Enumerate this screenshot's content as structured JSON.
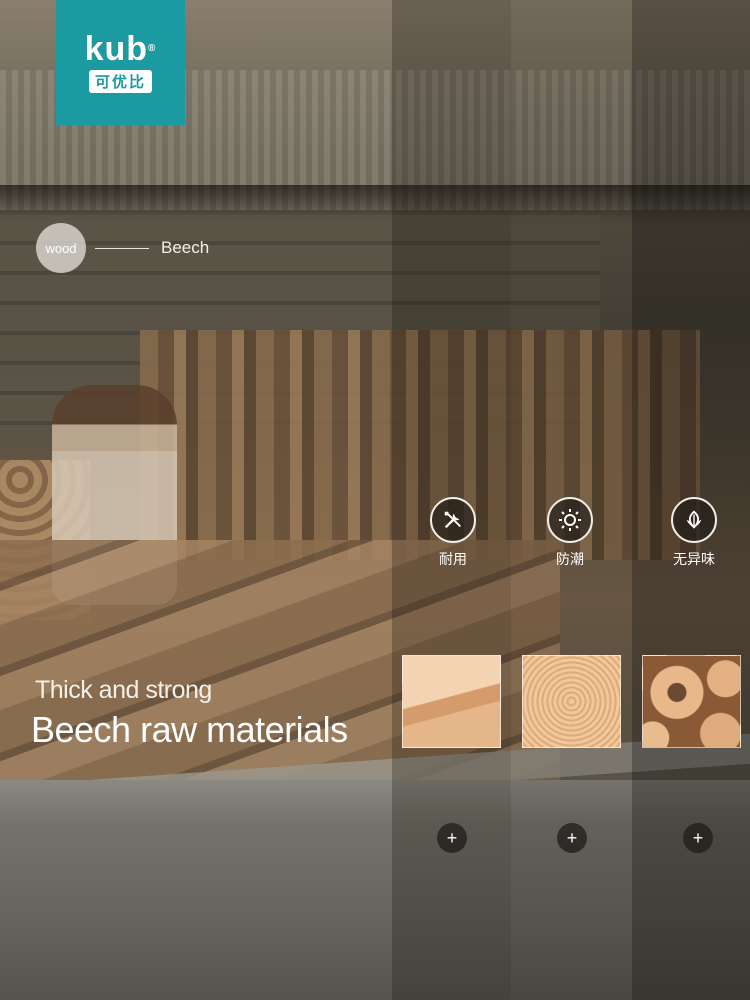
{
  "brand": {
    "logo_mark": "kub",
    "logo_cn": "可优比"
  },
  "wood_tag": {
    "badge": "wood",
    "label": "Beech"
  },
  "features": [
    {
      "label": "耐用",
      "icon": "tools-icon"
    },
    {
      "label": "防潮",
      "icon": "sun-shield-icon"
    },
    {
      "label": "无异味",
      "icon": "leaf-icon"
    }
  ],
  "headline": {
    "subtitle": "Thick and strong",
    "title": "Beech raw materials"
  },
  "swatches": [
    {
      "name": "beech-board"
    },
    {
      "name": "wood-rings"
    },
    {
      "name": "wood-beads"
    }
  ],
  "plus_symbol": "+"
}
